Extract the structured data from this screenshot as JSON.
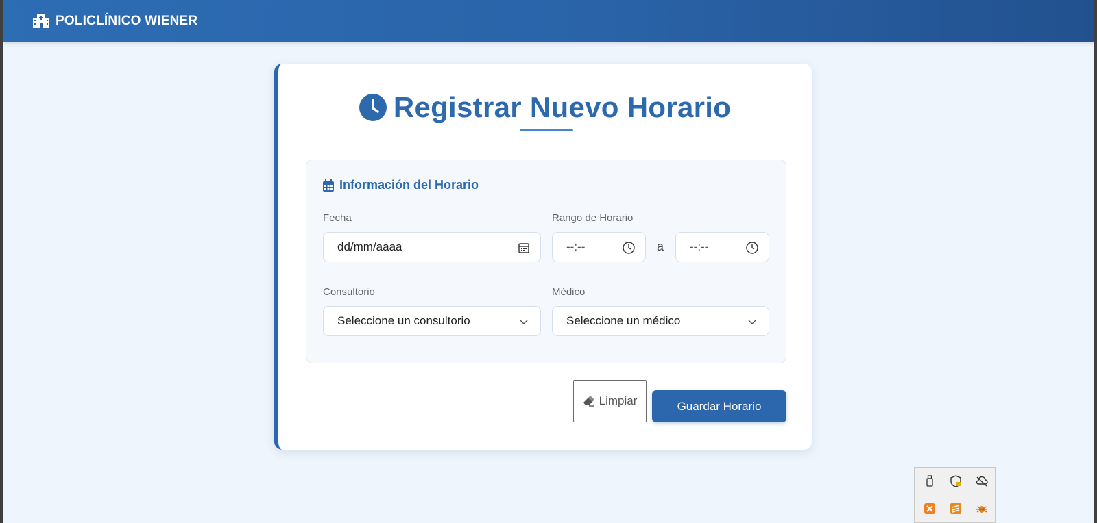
{
  "app": {
    "brand": "POLICLÍNICO WIENER",
    "brand_icon": "hospital-icon"
  },
  "form": {
    "title": "Registrar Nuevo Horario",
    "title_icon": "clock-icon",
    "section_title": "Información del Horario",
    "section_icon": "calendar-icon",
    "fecha_label": "Fecha",
    "fecha_value": "dd/mm/aaaa",
    "rango_label": "Rango de Horario",
    "hora_inicio": "--:--",
    "separator": "a",
    "hora_fin": "--:--",
    "consultorio_label": "Consultorio",
    "consultorio_value": "Seleccione un consultorio",
    "medico_label": "Médico",
    "medico_value": "Seleccione un médico",
    "clear_label": "Limpiar",
    "save_label": "Guardar Horario"
  },
  "colors": {
    "primary": "#2c66ad",
    "background": "#eef5fc",
    "card": "#ffffff",
    "section_bg": "#f5f9fd"
  },
  "tray_icons": [
    "usb-drive-icon",
    "security-shield-icon",
    "cloud-off-icon",
    "xampp-icon",
    "sublime-icon",
    "bug-icon"
  ]
}
